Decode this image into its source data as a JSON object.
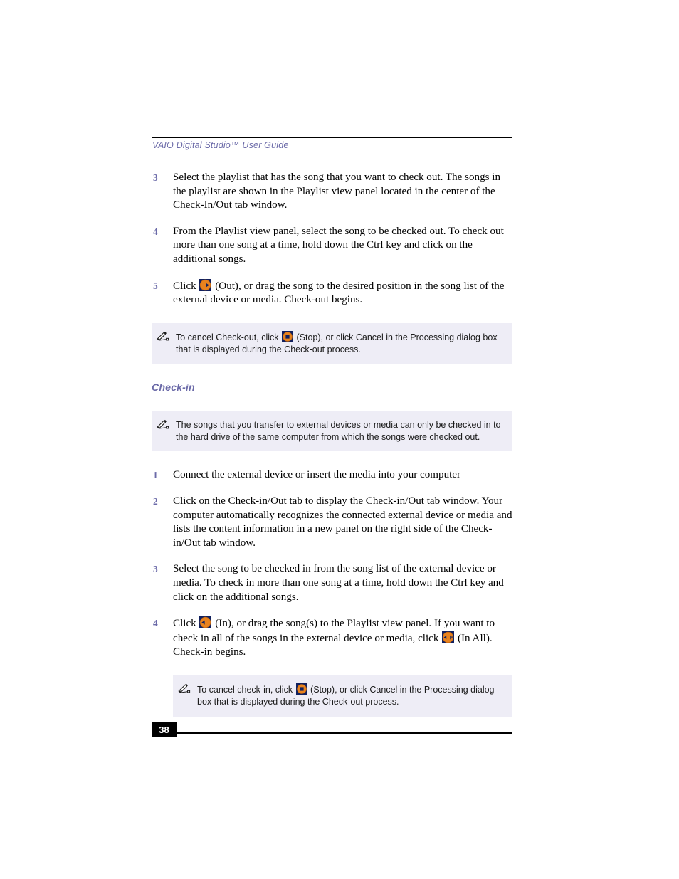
{
  "document": {
    "header_title": "VAIO Digital Studio™ User Guide",
    "page_number": "38"
  },
  "checkout_steps": [
    {
      "number": "3",
      "text": "Select the playlist that has the song that you want to check out. The songs in the playlist are shown in the Playlist view panel located in the center of the Check-In/Out tab window."
    },
    {
      "number": "4",
      "text": "From the Playlist view panel, select the song to be checked out. To check out more than one song at a time, hold down the Ctrl key and click on the additional songs."
    }
  ],
  "step5": {
    "number": "5",
    "text_before": "Click",
    "icon": "out-arrow-icon",
    "text_after": "(Out), or drag the song to the desired position in the song list of the external device or media. Check-out begins."
  },
  "note_checkout": {
    "icon": "pencil-note-icon",
    "text_before": "To cancel Check-out, click",
    "inline_icon": "stop-icon",
    "text_after": "(Stop), or click Cancel in the Processing dialog box that is displayed during the Check-out process."
  },
  "checkin_section": {
    "heading": "Check-in",
    "note": {
      "icon": "pencil-note-icon",
      "text": "The songs that you transfer to external devices or media can only be checked in to the hard drive of the same computer from which the songs were checked out."
    },
    "steps": [
      {
        "number": "1",
        "text": "Connect the external device or insert the media into your computer"
      },
      {
        "number": "2",
        "text": "Click on the Check-in/Out tab to display the Check-in/Out tab window. Your computer automatically recognizes the connected external device or media and lists the content information in a new panel on the right side of the Check-in/Out tab window."
      },
      {
        "number": "3",
        "text": "Select the song to be checked in from the song list of the external device or media. To check in more than one song at a time, hold down the Ctrl key and click on the additional songs."
      }
    ],
    "step4": {
      "number": "4",
      "text_before": "Click",
      "icon_in": "in-arrow-icon",
      "text_middle": "(In), or drag the song(s) to the Playlist view panel. If you want to check in all of the songs in the external device or media, click",
      "icon_in_all": "in-all-arrow-icon",
      "text_after": "(In All). Check-in begins."
    },
    "note_checkin": {
      "icon": "pencil-note-icon",
      "text_before": "To cancel check-in, click",
      "inline_icon": "stop-icon",
      "text_after": "(Stop), or click Cancel in the Processing dialog box that is displayed during the Check-out process."
    }
  },
  "colors": {
    "accent_purple": "#6b6aa8",
    "note_background": "#eeedf6",
    "icon_orange": "#e8821e",
    "icon_navy": "#1b2a6b"
  }
}
